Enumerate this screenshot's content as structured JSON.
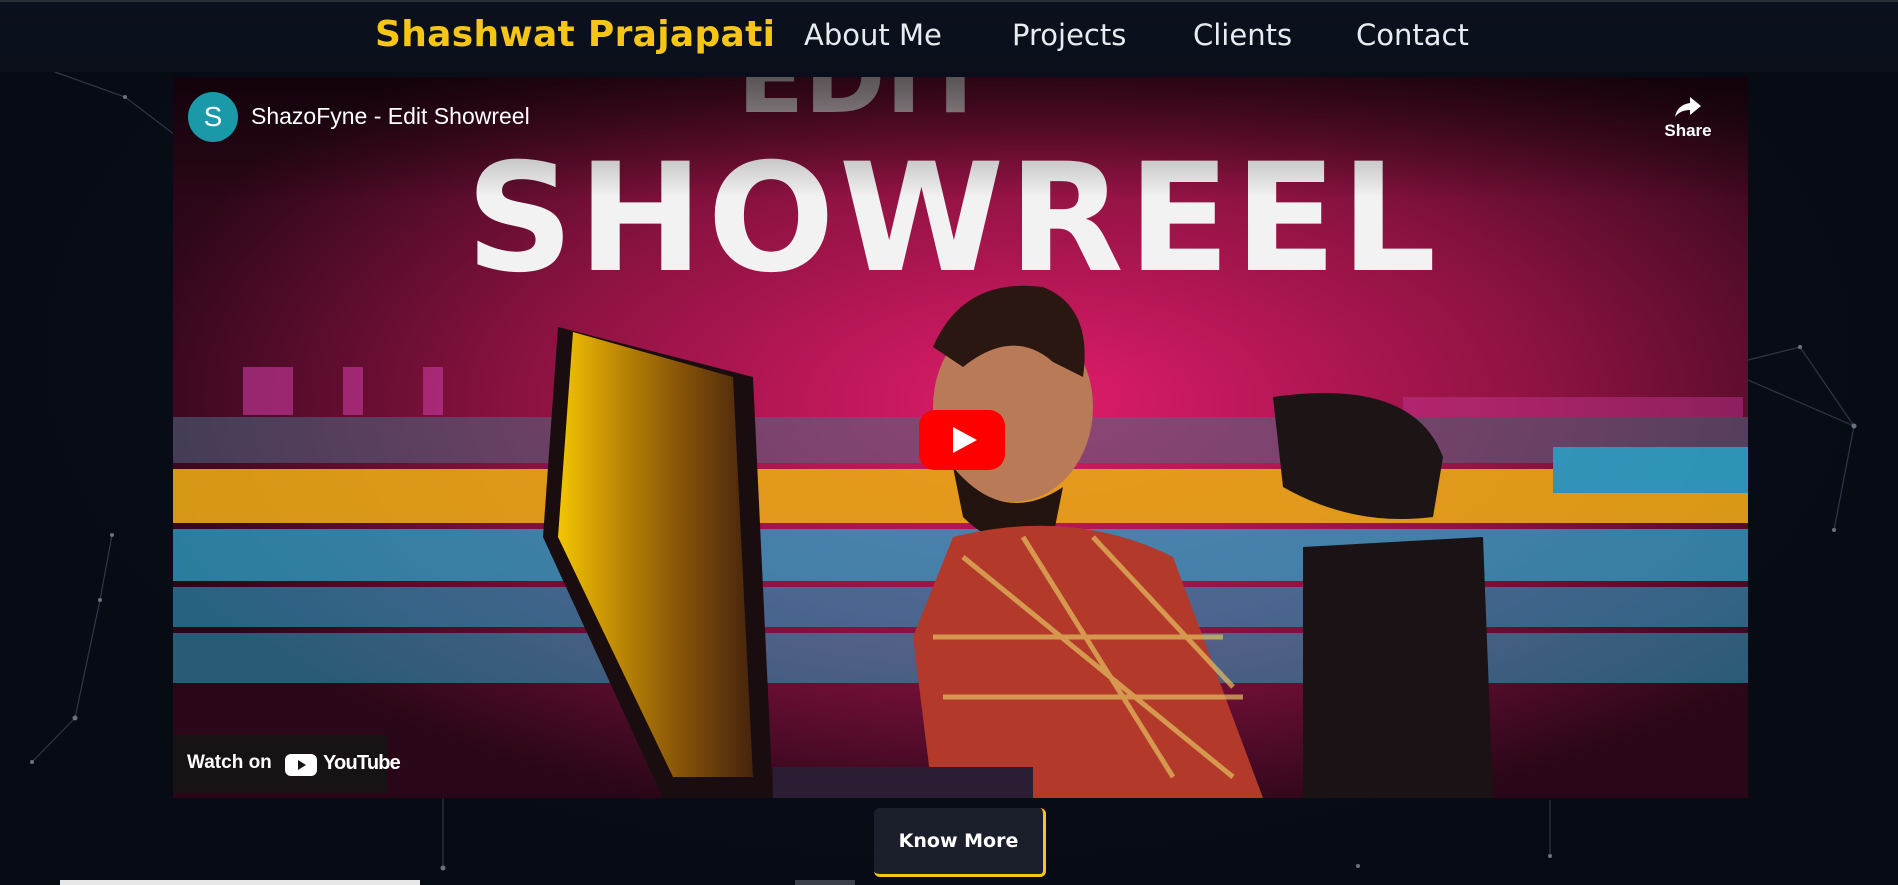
{
  "header": {
    "brand": "Shashwat Prajapati",
    "nav": [
      "About Me",
      "Projects",
      "Clients",
      "Contact"
    ]
  },
  "video": {
    "channel_initial": "S",
    "title": "ShazoFyne - Edit Showreel",
    "share_label": "Share",
    "thumbnail_top_text": "EDIT",
    "thumbnail_main_text": "SHOWREEL",
    "watch_on_label": "Watch on",
    "youtube_wordmark": "YouTube"
  },
  "cta": {
    "label": "Know More"
  },
  "colors": {
    "accent": "#f5c518",
    "background": "#070b14",
    "youtube_red": "#ff0000",
    "avatar": "#1a9aa8"
  },
  "icons": [
    "share-icon",
    "play-icon",
    "youtube-logo-icon"
  ]
}
